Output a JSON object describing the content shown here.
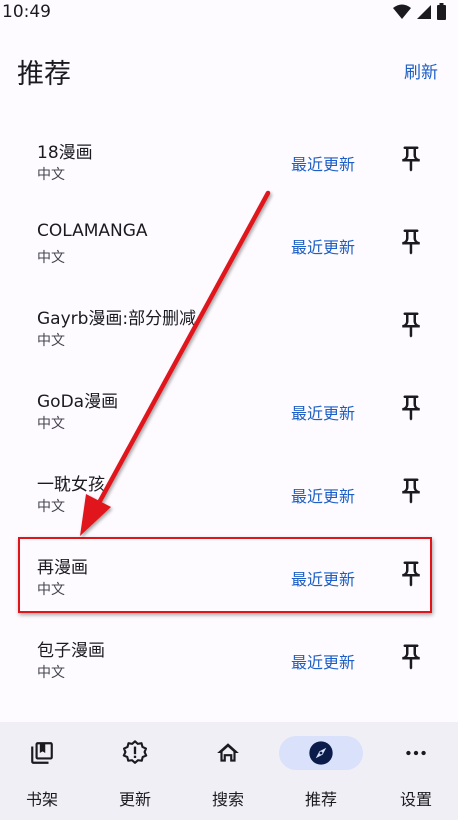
{
  "status": {
    "time": "10:49"
  },
  "header": {
    "title": "推荐",
    "refresh_label": "刷新"
  },
  "sources": [
    {
      "name": "18漫画",
      "language": "中文",
      "action": "最近更新"
    },
    {
      "name": "COLAMANGA",
      "language": "中文",
      "action": "最近更新"
    },
    {
      "name": "Gayrb漫画:部分删减",
      "language": "中文",
      "action": ""
    },
    {
      "name": "GoDa漫画",
      "language": "中文",
      "action": "最近更新"
    },
    {
      "name": "一耽女孩",
      "language": "中文",
      "action": "最近更新"
    },
    {
      "name": "再漫画",
      "language": "中文",
      "action": "最近更新"
    },
    {
      "name": "包子漫画",
      "language": "中文",
      "action": "最近更新"
    }
  ],
  "nav": {
    "items": [
      {
        "label": "书架",
        "icon": "library-icon"
      },
      {
        "label": "更新",
        "icon": "updates-alert-icon"
      },
      {
        "label": "搜索",
        "icon": "home-icon"
      },
      {
        "label": "推荐",
        "icon": "compass-icon"
      },
      {
        "label": "设置",
        "icon": "more-horizontal-icon"
      }
    ],
    "active_index": 3
  },
  "colors": {
    "accent": "#1d5fc4",
    "annotation": "#e0151a",
    "nav_background": "#f1eff6",
    "nav_active_pill": "#d9e1fb"
  }
}
